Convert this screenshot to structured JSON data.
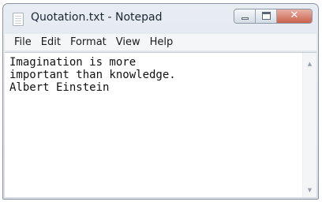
{
  "window": {
    "title": "Quotation.txt - Notepad",
    "icon": "notepad-icon"
  },
  "controls": {
    "minimize_icon": "minimize-icon",
    "maximize_icon": "maximize-icon",
    "close_glyph": "✕"
  },
  "menu": {
    "file": "File",
    "edit": "Edit",
    "format": "Format",
    "view": "View",
    "help": "Help"
  },
  "document": {
    "text": "Imagination is more\nimportant than knowledge.\nAlbert Einstein"
  },
  "scrollbar": {
    "up_arrow": "▲",
    "down_arrow": "▼"
  }
}
